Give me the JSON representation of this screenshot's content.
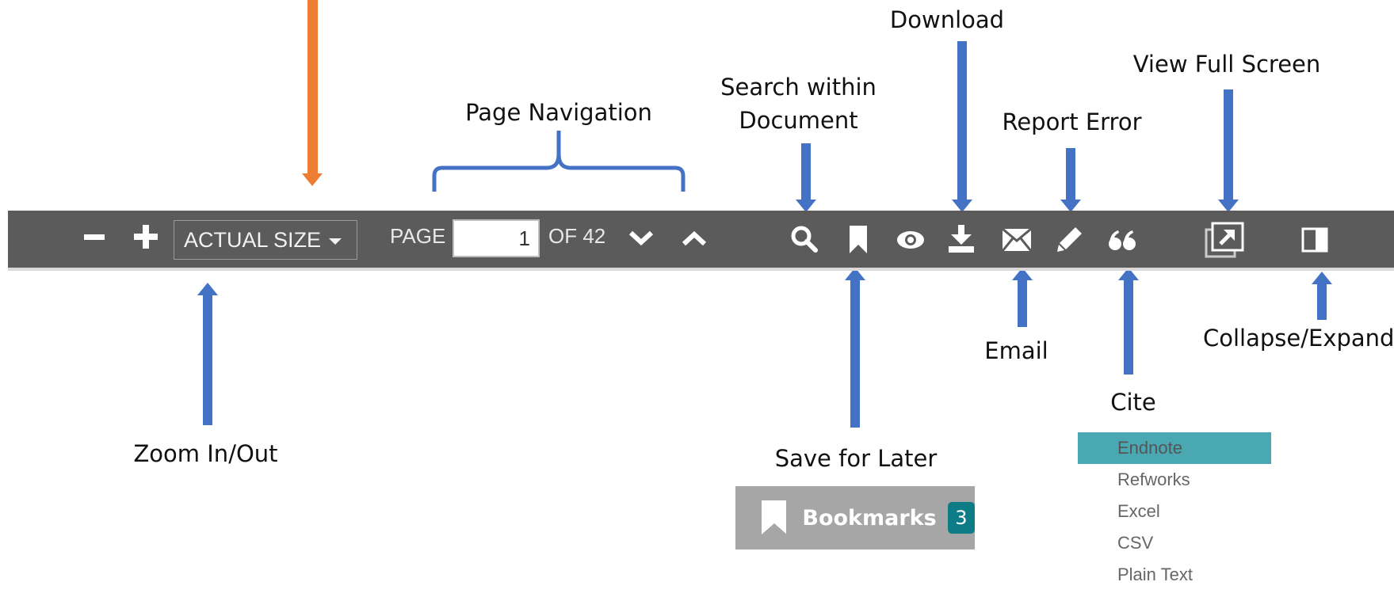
{
  "toolbar": {
    "zoom_out_icon": "minus-icon",
    "zoom_in_icon": "plus-icon",
    "zoom_value": "ACTUAL SIZE",
    "page_label": "PAGE",
    "page_value": "1",
    "page_of": "OF 42",
    "next_icon": "chevron-down-icon",
    "prev_icon": "chevron-up-icon",
    "icons": [
      "search-icon",
      "bookmark-icon",
      "eye-icon",
      "download-icon",
      "email-icon",
      "pencil-icon",
      "quote-icon",
      "fullscreen-icon",
      "collapse-panel-icon"
    ],
    "colors": {
      "bar": "#5b5b5b",
      "icon": "#ffffff",
      "arrow": "#4472c4",
      "orange_arrow": "#ed7d31"
    }
  },
  "annotations": {
    "download": "Download",
    "view_full_screen": "View Full Screen",
    "search_within_line1": "Search within",
    "search_within_line2": "Document",
    "report_error": "Report Error",
    "page_navigation": "Page Navigation",
    "email": "Email",
    "collapse_expand": "Collapse/Expand",
    "cite": "Cite",
    "zoom_in_out": "Zoom In/Out",
    "save_for_later": "Save for Later"
  },
  "bookmarks": {
    "label": "Bookmarks",
    "count": "3",
    "badge_color": "#0e7c86"
  },
  "cite_menu": {
    "items": [
      "Endnote",
      "Refworks",
      "Excel",
      "CSV",
      "Plain Text"
    ],
    "selected": "Endnote",
    "highlight_color": "#4aa8b3"
  }
}
